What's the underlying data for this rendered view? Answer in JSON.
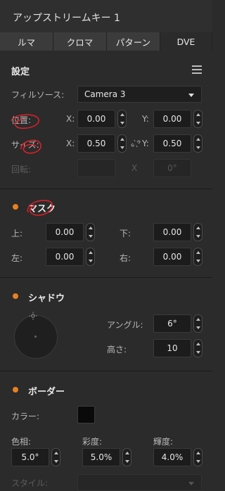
{
  "panel": {
    "title": "アップストリームキー 1"
  },
  "tabs": [
    {
      "label": "ルマ"
    },
    {
      "label": "クロマ"
    },
    {
      "label": "パターン"
    },
    {
      "label": "DVE"
    }
  ],
  "settings": {
    "title": "設定",
    "fill_source": {
      "label": "フィルソース:",
      "value": "Camera 3"
    },
    "position": {
      "label": "位置:",
      "x_label": "X:",
      "x_value": "0.00",
      "y_label": "Y:",
      "y_value": "0.00"
    },
    "size": {
      "label": "サイズ:",
      "x_label": "X:",
      "x_value": "0.50",
      "y_label": "Y:",
      "y_value": "0.50"
    },
    "rotation": {
      "label": "回転:",
      "x_label": "X",
      "value": "0°"
    }
  },
  "mask": {
    "title": "マスク",
    "top": {
      "label": "上:",
      "value": "0.00"
    },
    "bottom": {
      "label": "下:",
      "value": "0.00"
    },
    "left": {
      "label": "左:",
      "value": "0.00"
    },
    "right": {
      "label": "右:",
      "value": "0.00"
    }
  },
  "shadow": {
    "title": "シャドウ",
    "angle": {
      "label": "アングル:",
      "value": "6°"
    },
    "height": {
      "label": "高さ:",
      "value": "10"
    }
  },
  "border": {
    "title": "ボーダー",
    "color_label": "カラー:",
    "hue": {
      "label": "色相:",
      "value": "5.0°"
    },
    "saturation": {
      "label": "彩度:",
      "value": "5.0%"
    },
    "luminance": {
      "label": "輝度:",
      "value": "4.0%"
    },
    "style_label": "スタイル:"
  },
  "colors": {
    "accent": "#e8801f",
    "annotation": "#e0202a",
    "swatch": "#0a0a0a"
  }
}
